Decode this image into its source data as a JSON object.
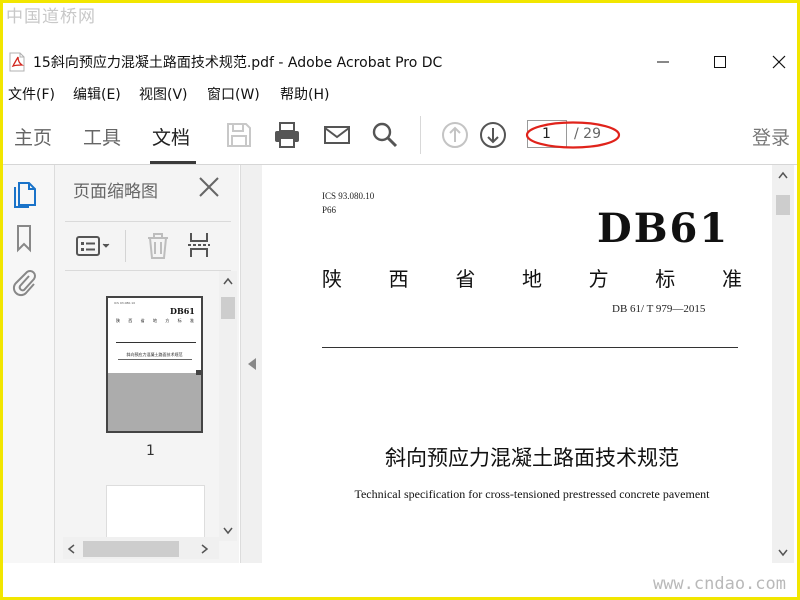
{
  "watermark": {
    "top": "中国道桥网",
    "bottom": "www.cndao.com"
  },
  "titlebar": {
    "title": "15斜向预应力混凝土路面技术规范.pdf - Adobe Acrobat Pro DC"
  },
  "menu": [
    "文件(F)",
    "编辑(E)",
    "视图(V)",
    "窗口(W)",
    "帮助(H)"
  ],
  "toolbar": {
    "tabs": [
      "主页",
      "工具",
      "文档"
    ],
    "active_tab": "文档",
    "page_current": "1",
    "page_total": "/ 29",
    "login": "登录"
  },
  "panel": {
    "title": "页面缩略图",
    "thumb_label": "1"
  },
  "thumb_text": {
    "logo": "DB61"
  },
  "document": {
    "ics": "ICS 93.080.10",
    "code_p": "P66",
    "logo": "DB61",
    "std_chars": [
      "陕",
      "西",
      "省",
      "地",
      "方",
      "标",
      "准"
    ],
    "std_code": "DB 61/ T 979—2015",
    "title_cn": "斜向预应力混凝土路面技术规范",
    "title_en": "Technical specification for cross-tensioned prestressed concrete pavement"
  },
  "colors": {
    "frame": "#f2e600",
    "accent_blue": "#1a73c9",
    "annotation": "#e0231b"
  },
  "icons": [
    "pdf-file-icon",
    "save-icon",
    "print-icon",
    "mail-icon",
    "search-icon",
    "arrow-up-icon",
    "arrow-down-icon",
    "pages-icon",
    "bookmark-icon",
    "paperclip-icon",
    "close-icon",
    "options-icon",
    "trash-icon",
    "extract-icon",
    "collapse-arrow-icon"
  ]
}
